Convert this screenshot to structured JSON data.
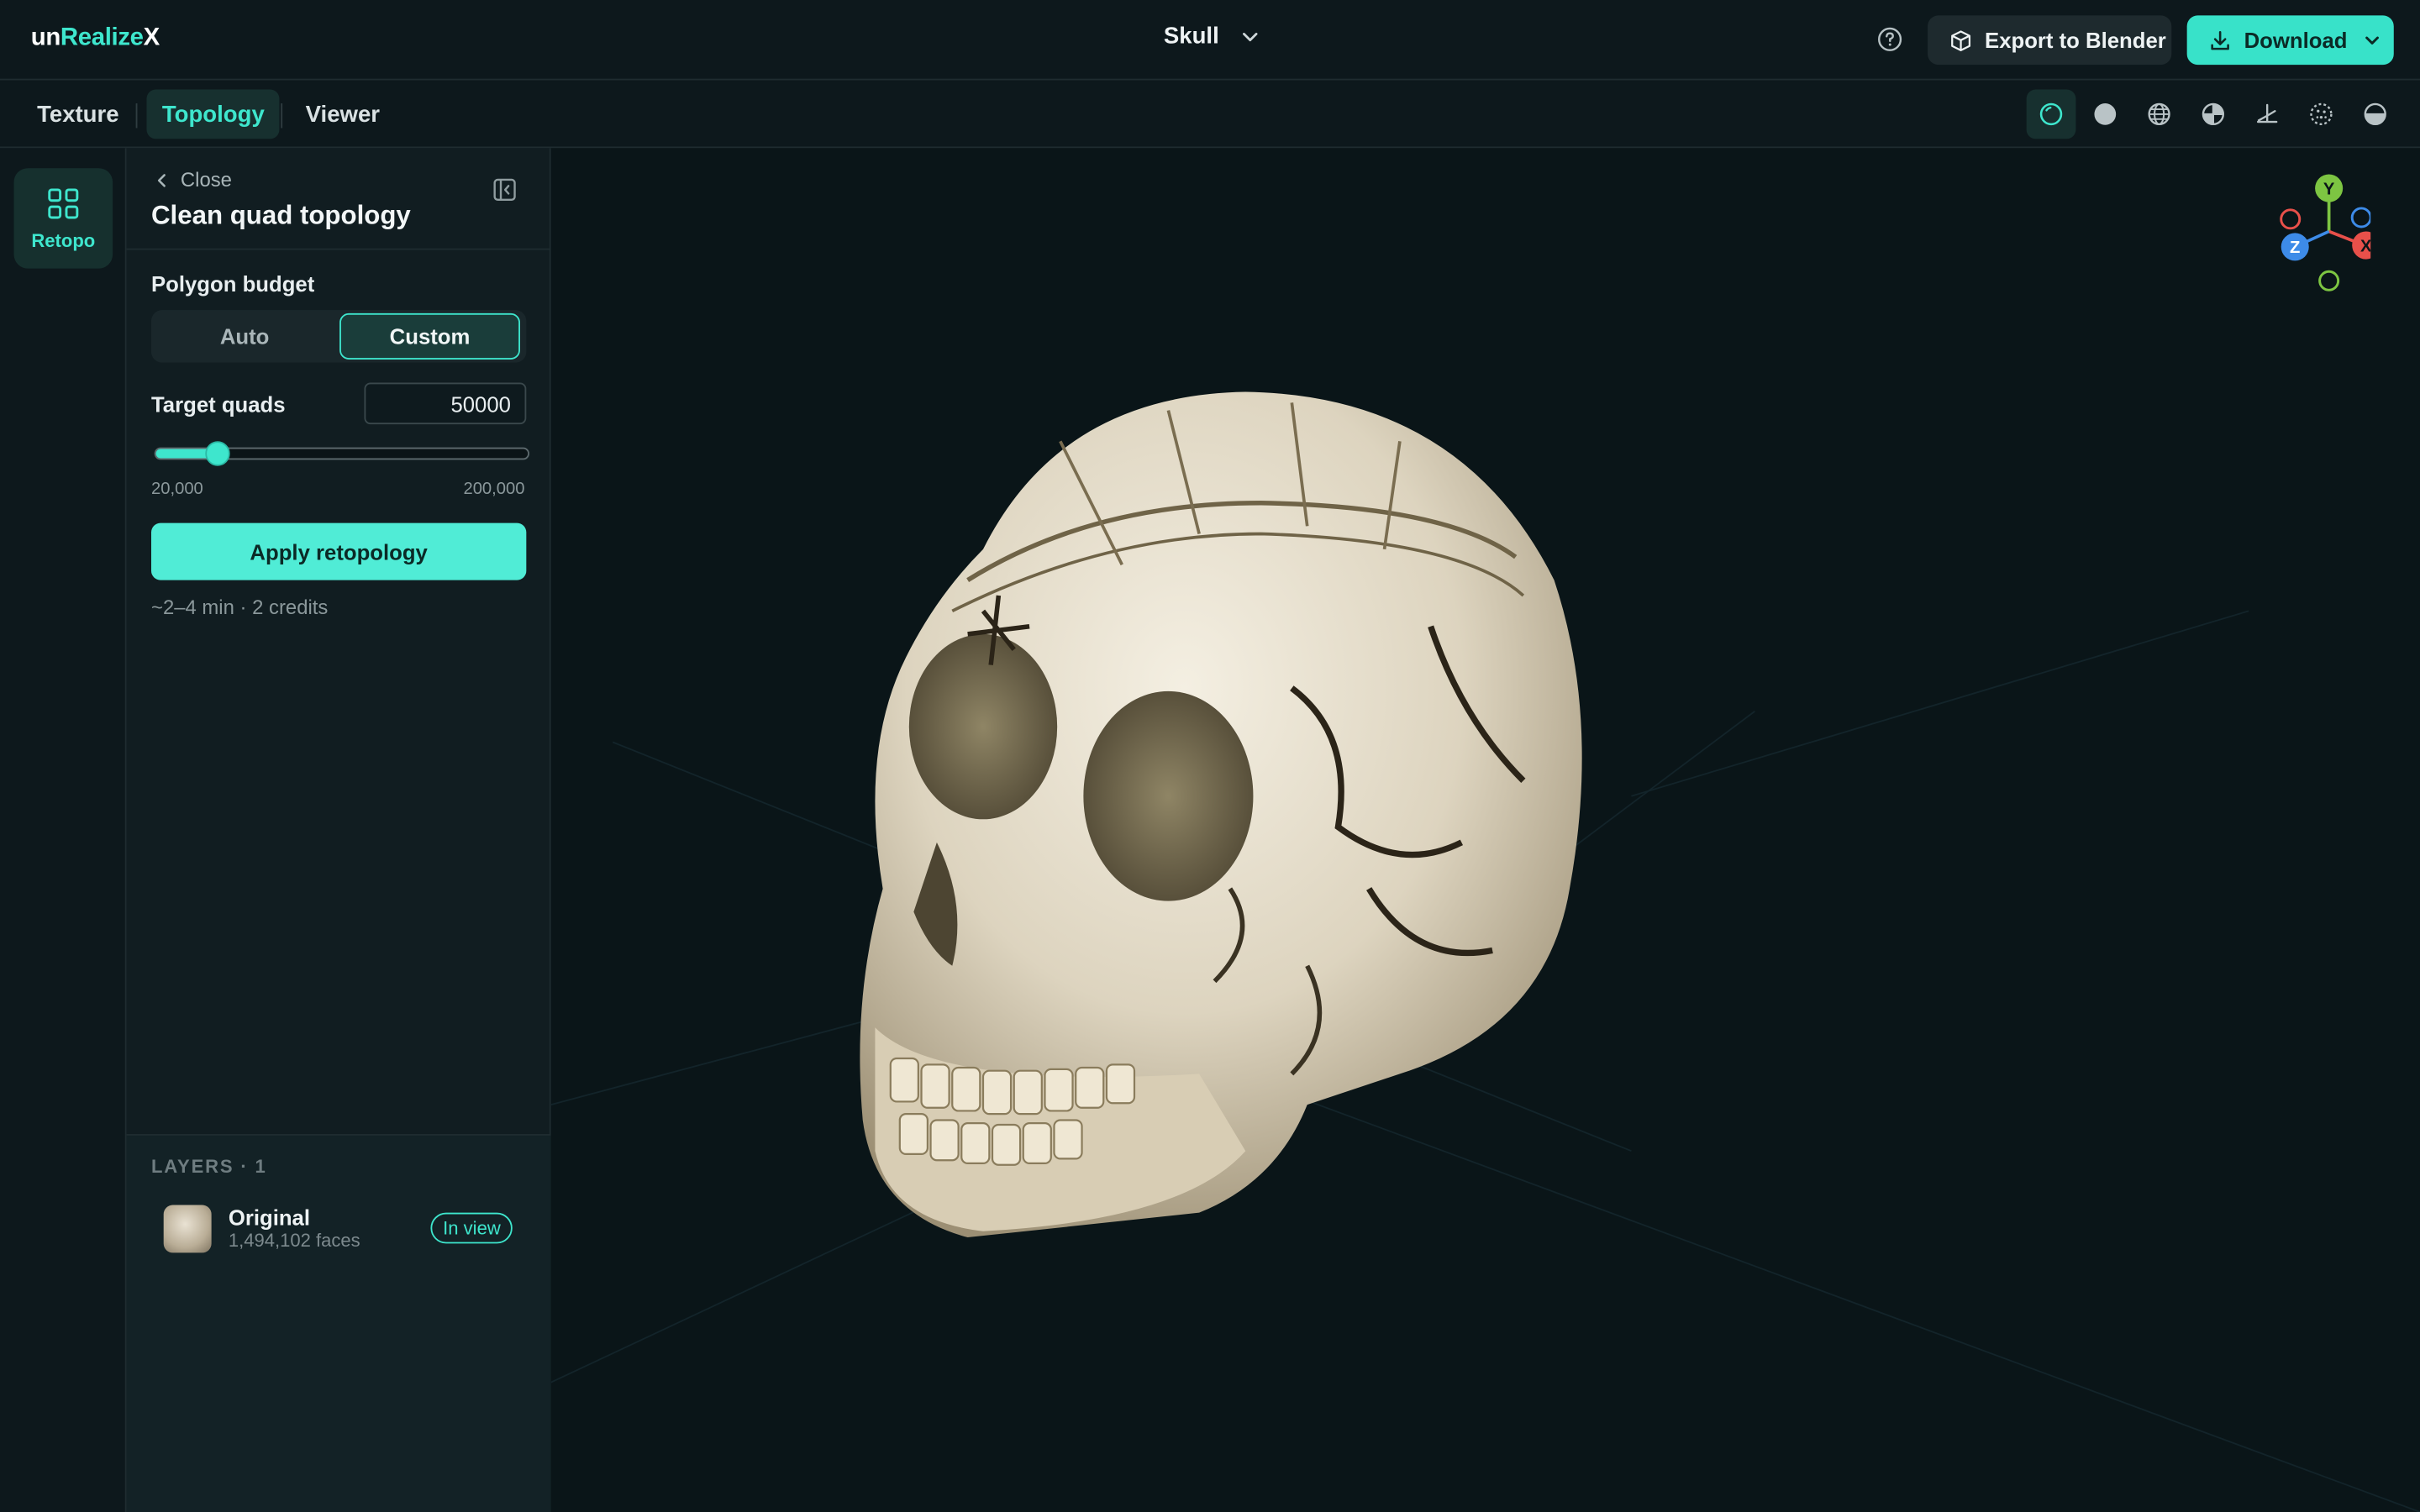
{
  "app": {
    "logo_part1": "un",
    "logo_part2": "Realize",
    "logo_part3": "X",
    "project_name": "Skull"
  },
  "header": {
    "export_label": "Export to Blender",
    "download_label": "Download"
  },
  "tabs": [
    {
      "label": "Texture"
    },
    {
      "label": "Topology",
      "active": true
    },
    {
      "label": "Viewer"
    }
  ],
  "view_modes": [
    "lit-sphere-icon",
    "solid-sphere-icon",
    "wireframe-globe-icon",
    "quadrant-sphere-icon",
    "ground-plane-icon",
    "points-sphere-icon",
    "half-sphere-icon"
  ],
  "rail": {
    "retopo_label": "Retopo"
  },
  "panel": {
    "close_label": "Close",
    "title": "Clean quad topology",
    "polygon_budget_label": "Polygon budget",
    "segment_options": [
      "Auto",
      "Custom"
    ],
    "segment_selected": "Custom",
    "target_label": "Target quads",
    "target_value": "50000",
    "slider_min_label": "20,000",
    "slider_max_label": "200,000",
    "slider_level": 0.1667,
    "apply_label": "Apply retopology",
    "estimate": "~2–4 min · 2 credits"
  },
  "layers": {
    "header": "LAYERS · 1",
    "items": [
      {
        "name": "Original",
        "faces": "1,494,102 faces",
        "badge": "In view"
      }
    ]
  },
  "gizmo": {
    "y_label": "Y",
    "x_label": "X",
    "z_label": "Z"
  },
  "colors": {
    "accent": "#3ee6cd",
    "background": "#0b1519",
    "axis_x": "#e8504a",
    "axis_y": "#7dc542",
    "axis_z": "#3d8be8"
  }
}
